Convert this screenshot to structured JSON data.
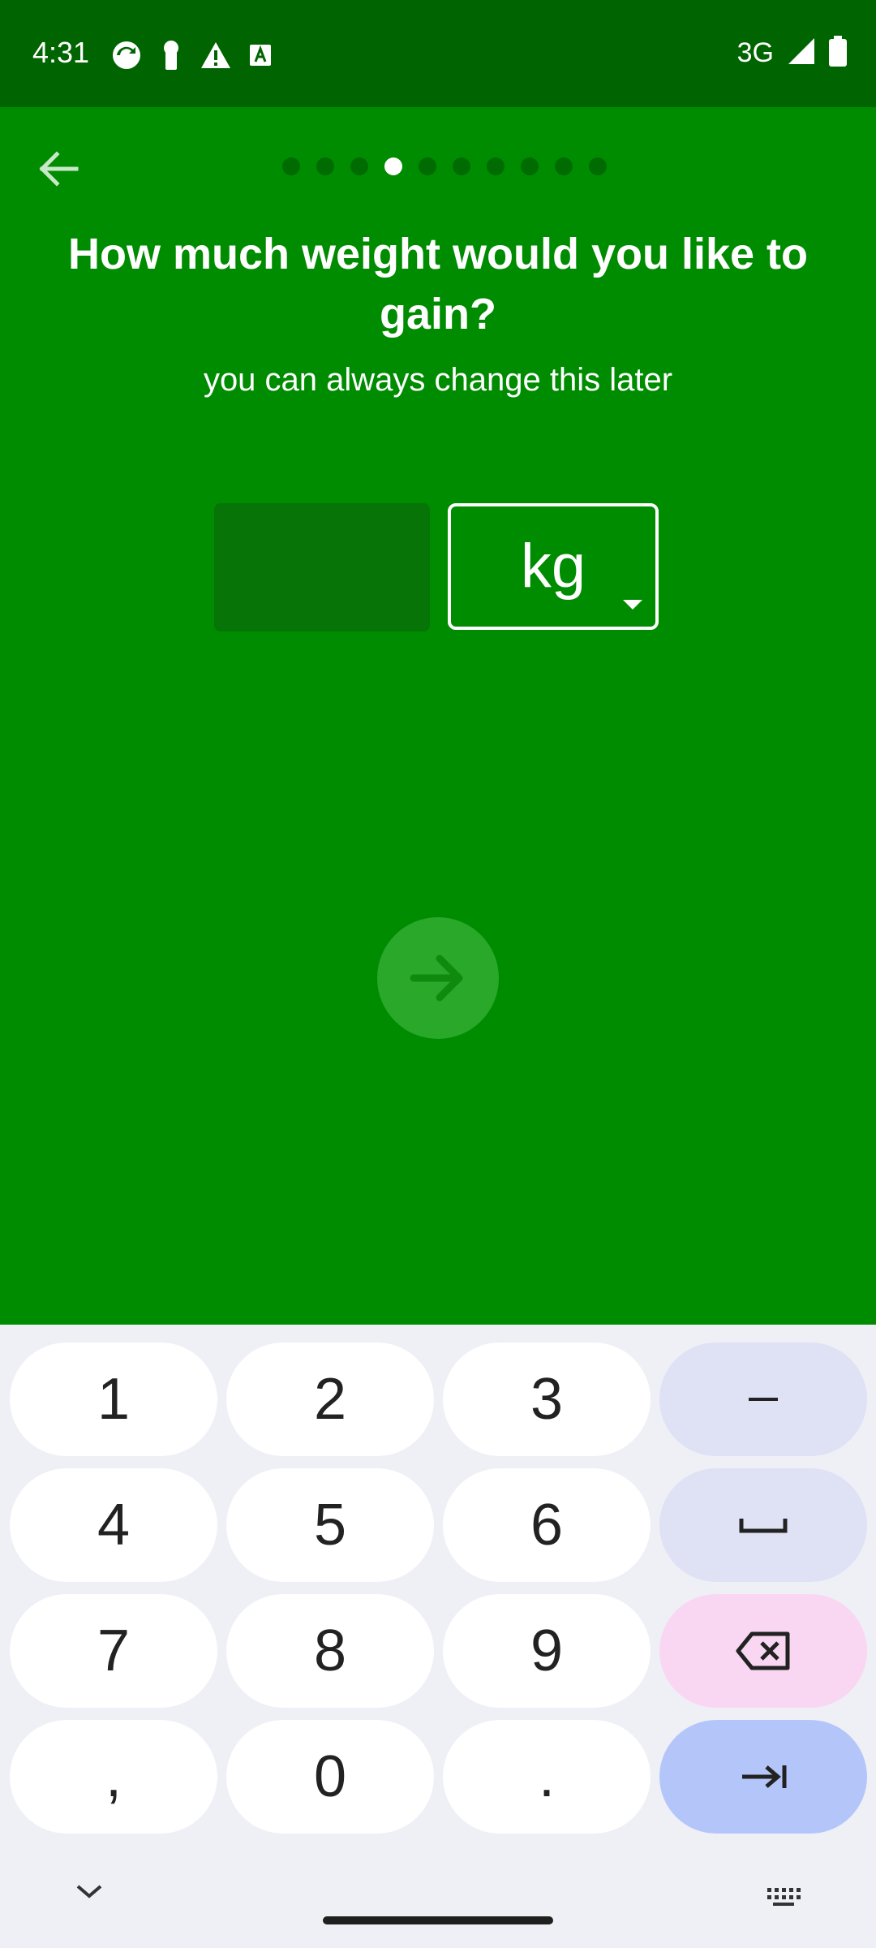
{
  "status_bar": {
    "time": "4:31",
    "network": "3G",
    "icons": [
      "sync-icon",
      "keyhole-icon",
      "warning-icon",
      "font-icon",
      "signal-icon",
      "battery-icon"
    ]
  },
  "onboarding": {
    "step_count": 10,
    "current_step": 4,
    "title": "How much weight would you like to gain?",
    "subtitle": "you can always change this later",
    "weight_value": "",
    "unit_selected": "kg"
  },
  "keyboard": {
    "keys": [
      "1",
      "2",
      "3",
      "–",
      "4",
      "5",
      "6",
      "␣",
      "7",
      "8",
      "9",
      "⌫",
      ",",
      "0",
      ".",
      "⇥"
    ]
  },
  "colors": {
    "background": "#008c00",
    "status_bar": "#006400",
    "input_fill": "#067406",
    "next_button": "#2aa82a",
    "keyboard_bg": "#efeff6"
  }
}
